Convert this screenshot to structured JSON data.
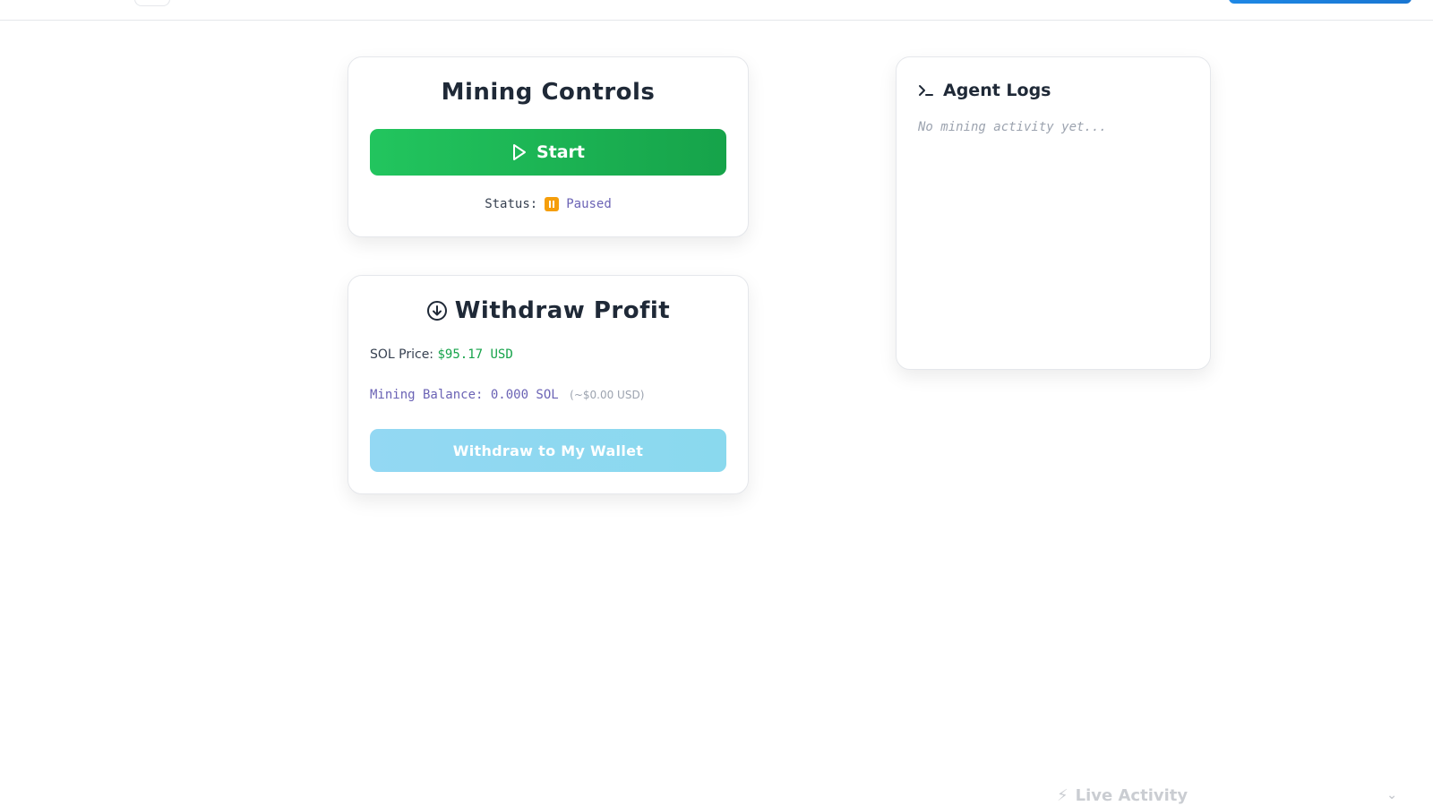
{
  "mining": {
    "title": "Mining Controls",
    "start_label": "Start",
    "status_label": "Status:",
    "status_value": "Paused"
  },
  "withdraw": {
    "title": "Withdraw Profit",
    "sol_price_label": "SOL Price:",
    "sol_price_value": "$95.17 USD",
    "balance_label": "Mining Balance: 0.000 SOL",
    "balance_usd": "(~$0.00 USD)",
    "button_label": "Withdraw to My Wallet"
  },
  "logs": {
    "title": "Agent Logs",
    "empty_message": "No mining activity yet..."
  },
  "live_activity": {
    "label": "Live Activity"
  },
  "colors": {
    "start_green": "#22c55e",
    "paused_amber": "#f59e0b",
    "withdraw_blue": "#8ad9ee",
    "price_green": "#16a34a"
  }
}
